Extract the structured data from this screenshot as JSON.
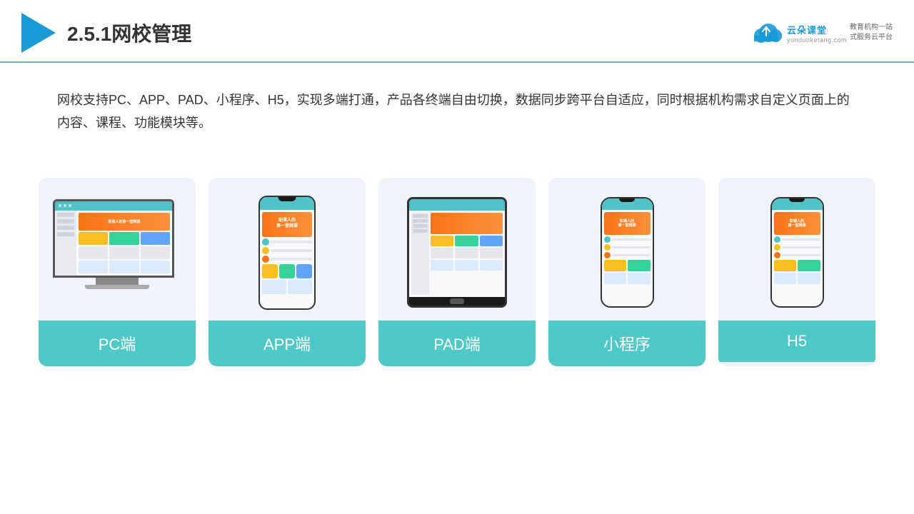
{
  "header": {
    "title": "2.5.1网校管理",
    "brand_name": "云朵课堂",
    "brand_url": "yunduoketang.com",
    "brand_tagline": "教育机构一站\n式服务云平台"
  },
  "description": {
    "text": "网校支持PC、APP、PAD、小程序、H5，实现多端打通，产品各终端自由切换，数据同步跨平台自适应，同时根据机构需求自定义页面上的内容、课程、功能模块等。"
  },
  "devices": [
    {
      "id": "pc",
      "label": "PC端"
    },
    {
      "id": "app",
      "label": "APP端"
    },
    {
      "id": "pad",
      "label": "PAD端"
    },
    {
      "id": "miniprogram",
      "label": "小程序"
    },
    {
      "id": "h5",
      "label": "H5"
    }
  ],
  "colors": {
    "teal": "#4ec9c7",
    "accent": "#1a9ad6",
    "border": "#4fc3c7",
    "card_bg": "#f0f4fa",
    "orange": "#f97316"
  }
}
